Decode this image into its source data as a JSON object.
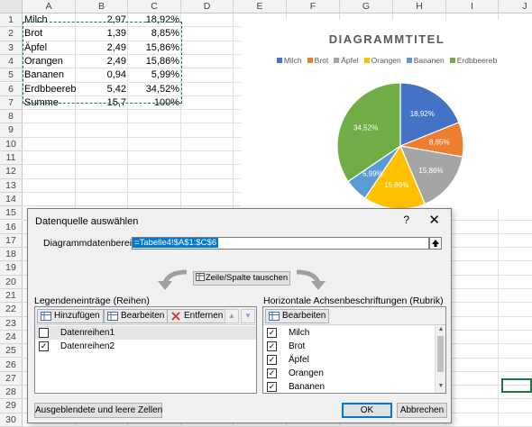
{
  "sheet": {
    "columns": [
      "A",
      "B",
      "C",
      "D",
      "E",
      "F",
      "G",
      "H",
      "I",
      "J"
    ],
    "rows": [
      "1",
      "2",
      "3",
      "4",
      "5",
      "6",
      "7",
      "8",
      "9",
      "10",
      "11",
      "12",
      "13",
      "14",
      "15",
      "16",
      "17",
      "18",
      "19",
      "20",
      "21",
      "22",
      "23",
      "24",
      "25",
      "26",
      "27",
      "28",
      "29",
      "30"
    ],
    "data": [
      [
        "Milch",
        "2,97",
        "18,92%"
      ],
      [
        "Brot",
        "1,39",
        "8,85%"
      ],
      [
        "Äpfel",
        "2,49",
        "15,86%"
      ],
      [
        "Orangen",
        "2,49",
        "15,86%"
      ],
      [
        "Bananen",
        "0,94",
        "5,99%"
      ],
      [
        "Erdbbeereb",
        "5,42",
        "34,52%"
      ],
      [
        "Summe",
        "15,7",
        "100%"
      ]
    ]
  },
  "chart": {
    "title": "DIAGRAMMTITEL",
    "legend": [
      "Milch",
      "Brot",
      "Äpfel",
      "Orangen",
      "Bananen",
      "Erdbbeereb"
    ],
    "colors": [
      "#4472c4",
      "#ed7d31",
      "#a5a5a5",
      "#ffc000",
      "#5b9bd5",
      "#70ad47"
    ]
  },
  "chart_data": {
    "type": "pie",
    "title": "DIAGRAMMTITEL",
    "categories": [
      "Milch",
      "Brot",
      "Äpfel",
      "Orangen",
      "Bananen",
      "Erdbbeereb"
    ],
    "values": [
      18.92,
      8.85,
      15.86,
      15.86,
      5.99,
      34.52
    ],
    "data_labels": [
      "18,92%",
      "8,85%",
      "15,86%",
      "15,86%",
      "5,99%",
      "34,52%"
    ],
    "legend_position": "top"
  },
  "dialog": {
    "title": "Datenquelle auswählen",
    "help": "?",
    "close": "✕",
    "range_label": "Diagrammdatenbereich:",
    "range_value": "=Tabelle4!$A$1:$C$6",
    "swap_label": "Zeile/Spalte tauschen",
    "legend_header": "Legendeneinträge (Reihen)",
    "axis_header": "Horizontale Achsenbeschriftungen (Rubrik)",
    "add_label": "Hinzufügen",
    "edit_label": "Bearbeiten",
    "remove_label": "Entfernen",
    "axis_edit_label": "Bearbeiten",
    "series": [
      {
        "label": "Datenreihen1",
        "checked": false
      },
      {
        "label": "Datenreihen2",
        "checked": true
      }
    ],
    "categories": [
      {
        "label": "Milch",
        "checked": true
      },
      {
        "label": "Brot",
        "checked": true
      },
      {
        "label": "Äpfel",
        "checked": true
      },
      {
        "label": "Orangen",
        "checked": true
      },
      {
        "label": "Bananen",
        "checked": true
      }
    ],
    "hidden_cells_label": "Ausgeblendete und leere Zellen",
    "ok_label": "OK",
    "cancel_label": "Abbrechen"
  }
}
